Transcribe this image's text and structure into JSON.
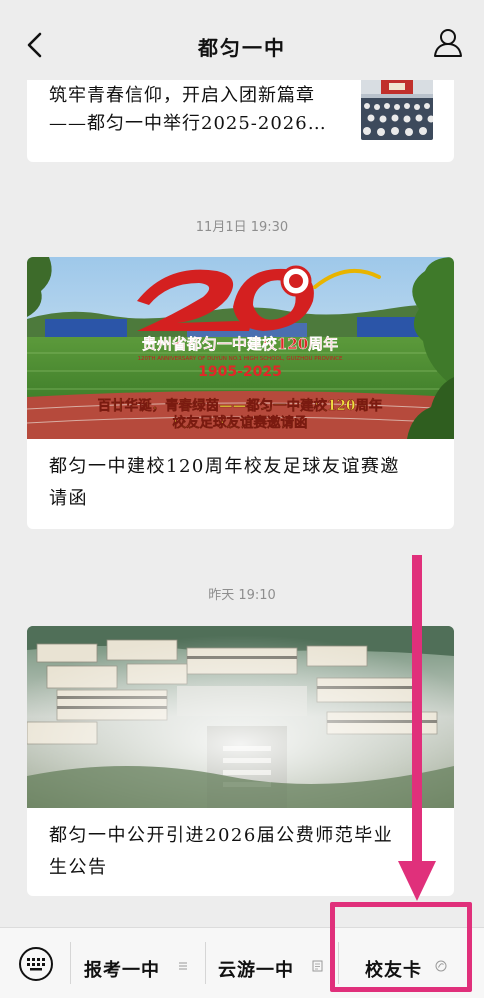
{
  "header": {
    "title": "都匀一中"
  },
  "articles": [
    {
      "line1": "筑牢青春信仰，开启入团新篇章",
      "line2": "——都匀一中举行2025-2026…"
    },
    {
      "time": "11月1日 19:30",
      "banner": {
        "title_cn": "贵州省都匀一中建校120周年",
        "title_en": "120TH ANNIVERSARY OF DUYUN NO.1 HIGH SCHOOL, GUIZHOU PROVINCE",
        "years": "1905-2025",
        "line1": "百廿华诞，青春绿茵——都匀一中建校120周年",
        "line2": "校友足球友谊赛邀请函"
      },
      "caption_line1": "都匀一中建校120周年校友足球友谊赛邀",
      "caption_line2": "请函"
    },
    {
      "time": "昨天 19:10",
      "caption_line1": "都匀一中公开引进2026届公费师范毕业",
      "caption_line2": "生公告"
    }
  ],
  "bottom_menu": [
    {
      "label": "报考一中"
    },
    {
      "label": "云游一中"
    },
    {
      "label": "校友卡"
    }
  ],
  "colors": {
    "accent": "#e0307b",
    "banner_red": "#d42020",
    "background": "#ededed"
  }
}
